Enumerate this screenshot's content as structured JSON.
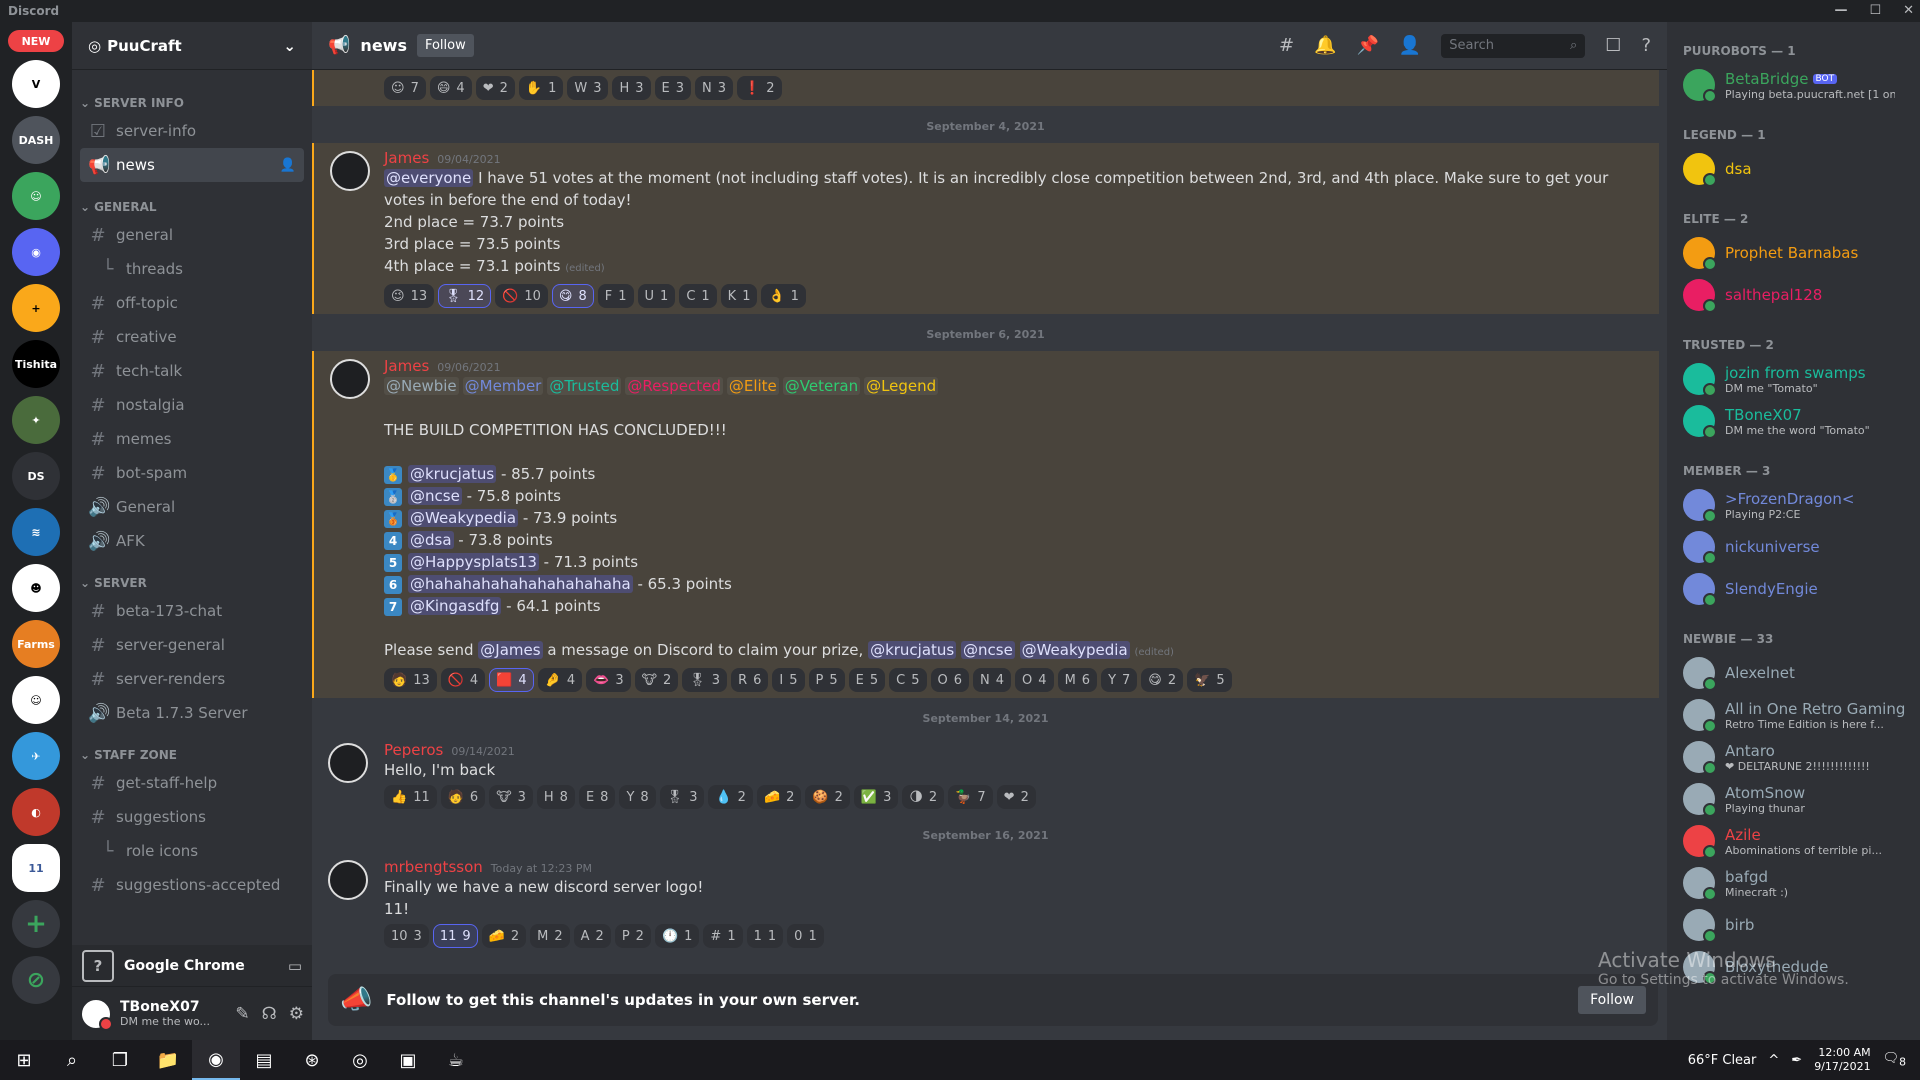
{
  "app": {
    "title": "Discord",
    "controls": [
      "—",
      "☐",
      "✕"
    ]
  },
  "guilds": {
    "new_badge": "NEW",
    "items": [
      {
        "name": "V",
        "color": "#ffffff",
        "fg": "#000000"
      },
      {
        "name": "DASH",
        "color": "#4f545c",
        "fg": "#ffffff"
      },
      {
        "name": "☺",
        "color": "#3ba55d",
        "fg": "#ffffff"
      },
      {
        "name": "◉",
        "color": "#5865f2",
        "fg": "#ffffff"
      },
      {
        "name": "+",
        "color": "#faa81a",
        "fg": "#000000"
      },
      {
        "name": "Tishita",
        "color": "#000000",
        "fg": "#ffffff"
      },
      {
        "name": "✦",
        "color": "#4a6b3c",
        "fg": "#ffffff"
      },
      {
        "name": "DS",
        "color": "#2f3136",
        "fg": "#ffffff"
      },
      {
        "name": "≋",
        "color": "#1e6fb4",
        "fg": "#ffffff"
      },
      {
        "name": "☻",
        "color": "#ffffff",
        "fg": "#000000"
      },
      {
        "name": "Farms",
        "color": "#e67e22",
        "fg": "#ffffff"
      },
      {
        "name": "☺",
        "color": "#ffffff",
        "fg": "#000000"
      },
      {
        "name": "✈",
        "color": "#3498db",
        "fg": "#ffffff"
      },
      {
        "name": "◐",
        "color": "#c0392b",
        "fg": "#ffffff"
      },
      {
        "name": "11",
        "color": "#ffffff",
        "fg": "#3b5998"
      }
    ],
    "add": "+",
    "explore": "⊘"
  },
  "server": {
    "name": "PuuCraft"
  },
  "categories": [
    {
      "name": "SERVER INFO",
      "channels": [
        {
          "sym": "☑",
          "name": "server-info",
          "active": false,
          "sub": false
        },
        {
          "sym": "📢",
          "name": "news",
          "active": true,
          "sub": false
        }
      ]
    },
    {
      "name": "GENERAL",
      "channels": [
        {
          "sym": "#",
          "name": "general",
          "active": false,
          "sub": false
        },
        {
          "sym": "└",
          "name": "threads",
          "active": false,
          "sub": true
        },
        {
          "sym": "#",
          "name": "off-topic",
          "active": false,
          "sub": false
        },
        {
          "sym": "#",
          "name": "creative",
          "active": false,
          "sub": false
        },
        {
          "sym": "#",
          "name": "tech-talk",
          "active": false,
          "sub": false
        },
        {
          "sym": "#",
          "name": "nostalgia",
          "active": false,
          "sub": false
        },
        {
          "sym": "#",
          "name": "memes",
          "active": false,
          "sub": false
        },
        {
          "sym": "#",
          "name": "bot-spam",
          "active": false,
          "sub": false
        },
        {
          "sym": "🔊",
          "name": "General",
          "active": false,
          "sub": false
        },
        {
          "sym": "🔊",
          "name": "AFK",
          "active": false,
          "sub": false
        }
      ]
    },
    {
      "name": "SERVER",
      "channels": [
        {
          "sym": "#",
          "name": "beta-173-chat",
          "active": false,
          "sub": false
        },
        {
          "sym": "#",
          "name": "server-general",
          "active": false,
          "sub": false
        },
        {
          "sym": "#",
          "name": "server-renders",
          "active": false,
          "sub": false
        },
        {
          "sym": "🔊",
          "name": "Beta 1.7.3 Server",
          "active": false,
          "sub": false
        }
      ]
    },
    {
      "name": "STAFF ZONE",
      "channels": [
        {
          "sym": "#",
          "name": "get-staff-help",
          "active": false,
          "sub": false
        },
        {
          "sym": "#",
          "name": "suggestions",
          "active": false,
          "sub": false
        },
        {
          "sym": "└",
          "name": "role icons",
          "active": false,
          "sub": true
        },
        {
          "sym": "#",
          "name": "suggestions-accepted",
          "active": false,
          "sub": false
        }
      ]
    }
  ],
  "activity": {
    "name": "Google Chrome",
    "icon": "?"
  },
  "user": {
    "name": "TBoneX07",
    "status": "DM me the wo..."
  },
  "channel": {
    "name": "news",
    "follow": "Follow",
    "search_placeholder": "Search"
  },
  "top_reactions": [
    {
      "e": "☺",
      "c": "7"
    },
    {
      "e": "😄",
      "c": "4"
    },
    {
      "e": "❤",
      "c": "2"
    },
    {
      "e": "✋",
      "c": "1"
    },
    {
      "e": "W",
      "c": "3"
    },
    {
      "e": "H",
      "c": "3"
    },
    {
      "e": "E",
      "c": "3"
    },
    {
      "e": "N",
      "c": "3"
    },
    {
      "e": "❗",
      "c": "2"
    }
  ],
  "messages": [
    {
      "date": "September 4, 2021",
      "author": "James",
      "ts": "09/04/2021",
      "hl": true,
      "lines": [
        {
          "mention": "@everyone",
          "text": " I have 51 votes at the moment (not including staff votes). It is an incredibly close competition between 2nd, 3rd, and 4th place. Make sure to get your votes in before the end of today!"
        },
        {
          "mention": "",
          "text": "2nd place = 73.7 points"
        },
        {
          "mention": "",
          "text": "3rd place = 73.5 points"
        },
        {
          "mention": "",
          "text": "4th place = 73.1 points",
          "edited": "(edited)"
        }
      ],
      "reactions": [
        {
          "e": "😉",
          "c": "13",
          "me": false
        },
        {
          "e": "🎖",
          "c": "12",
          "me": true
        },
        {
          "e": "🚫",
          "c": "10",
          "me": false
        },
        {
          "e": "😋",
          "c": "8",
          "me": true
        },
        {
          "e": "F",
          "c": "1",
          "me": false
        },
        {
          "e": "U",
          "c": "1",
          "me": false
        },
        {
          "e": "C",
          "c": "1",
          "me": false
        },
        {
          "e": "K",
          "c": "1",
          "me": false
        },
        {
          "e": "👌",
          "c": "1",
          "me": false
        }
      ]
    },
    {
      "date": "September 6, 2021",
      "author": "James",
      "ts": "09/06/2021",
      "hl": true,
      "roles": [
        "@Newbie",
        "@Member",
        "@Trusted",
        "@Respected",
        "@Elite",
        "@Veteran",
        "@Legend"
      ],
      "headline": "THE BUILD COMPETITION HAS CONCLUDED!!!",
      "ranks": [
        {
          "r": "🥇",
          "u": "@krucjatus",
          "p": " - 85.7 points"
        },
        {
          "r": "🥈",
          "u": "@ncse",
          "p": " - 75.8 points"
        },
        {
          "r": "🥉",
          "u": "@Weakypedia",
          "p": " - 73.9 points"
        },
        {
          "r": "4",
          "u": "@dsa",
          "p": " - 73.8 points"
        },
        {
          "r": "5",
          "u": "@Happysplats13",
          "p": " - 71.3 points"
        },
        {
          "r": "6",
          "u": "@hahahahahahahahahahaha",
          "p": " - 65.3 points"
        },
        {
          "r": "7",
          "u": "@Kingasdfg",
          "p": " - 64.1 points"
        }
      ],
      "closing": {
        "a": "Please send ",
        "m1": "@James",
        "b": " a message on Discord to claim your prize, ",
        "m2": "@krucjatus",
        "m3": "@ncse",
        "m4": "@Weakypedia",
        "edited": "(edited)"
      },
      "reactions": [
        {
          "e": "🧑",
          "c": "13",
          "me": false
        },
        {
          "e": "🚫",
          "c": "4",
          "me": false
        },
        {
          "e": "🟥",
          "c": "4",
          "me": true
        },
        {
          "e": "🤌",
          "c": "4",
          "me": false
        },
        {
          "e": "👄",
          "c": "3",
          "me": false
        },
        {
          "e": "🐮",
          "c": "2",
          "me": false
        },
        {
          "e": "🎖",
          "c": "3",
          "me": false
        },
        {
          "e": "R",
          "c": "6",
          "me": false
        },
        {
          "e": "I",
          "c": "5",
          "me": false
        },
        {
          "e": "P",
          "c": "5",
          "me": false
        },
        {
          "e": "E",
          "c": "5",
          "me": false
        },
        {
          "e": "C",
          "c": "5",
          "me": false
        },
        {
          "e": "O",
          "c": "6",
          "me": false
        },
        {
          "e": "N",
          "c": "4",
          "me": false
        },
        {
          "e": "O",
          "c": "4",
          "me": false
        },
        {
          "e": "M",
          "c": "6",
          "me": false
        },
        {
          "e": "Y",
          "c": "7",
          "me": false
        },
        {
          "e": "😋",
          "c": "2",
          "me": false
        },
        {
          "e": "🦅",
          "c": "5",
          "me": false
        }
      ]
    },
    {
      "date": "September 14, 2021",
      "author": "Peperos",
      "ts": "09/14/2021",
      "hl": false,
      "lines": [
        {
          "mention": "",
          "text": "Hello, I'm back"
        }
      ],
      "reactions": [
        {
          "e": "👍",
          "c": "11",
          "me": false
        },
        {
          "e": "🧑",
          "c": "6",
          "me": false
        },
        {
          "e": "🐮",
          "c": "3",
          "me": false
        },
        {
          "e": "H",
          "c": "8",
          "me": false
        },
        {
          "e": "E",
          "c": "8",
          "me": false
        },
        {
          "e": "Y",
          "c": "8",
          "me": false
        },
        {
          "e": "🎖",
          "c": "3",
          "me": false
        },
        {
          "e": "💧",
          "c": "2",
          "me": false
        },
        {
          "e": "🧀",
          "c": "2",
          "me": false
        },
        {
          "e": "🍪",
          "c": "2",
          "me": false
        },
        {
          "e": "✅",
          "c": "3",
          "me": false
        },
        {
          "e": "🌗",
          "c": "2",
          "me": false
        },
        {
          "e": "🦆",
          "c": "7",
          "me": false
        },
        {
          "e": "❤",
          "c": "2",
          "me": false
        }
      ]
    },
    {
      "date": "September 16, 2021",
      "author": "mrbengtsson",
      "ts": "Today at 12:23 PM",
      "hl": false,
      "lines": [
        {
          "mention": "",
          "text": "Finally we have a new discord server logo!"
        },
        {
          "mention": "",
          "text": "11!"
        }
      ],
      "reactions": [
        {
          "e": "10",
          "c": "3",
          "me": false
        },
        {
          "e": "11",
          "c": "9",
          "me": true
        },
        {
          "e": "🧀",
          "c": "2",
          "me": false
        },
        {
          "e": "M",
          "c": "2",
          "me": false
        },
        {
          "e": "A",
          "c": "2",
          "me": false
        },
        {
          "e": "P",
          "c": "2",
          "me": false
        },
        {
          "e": "🕛",
          "c": "1",
          "me": false
        },
        {
          "e": "#",
          "c": "1",
          "me": false
        },
        {
          "e": "1",
          "c": "1",
          "me": false
        },
        {
          "e": "0",
          "c": "1",
          "me": false
        }
      ]
    }
  ],
  "followbar": {
    "text": "Follow to get this channel's updates in your own server.",
    "button": "Follow"
  },
  "members": [
    {
      "cat": "PUUROBOTS — 1",
      "list": [
        {
          "n": "BetaBridge",
          "c": "#3ba55d",
          "bot": "BOT",
          "s": "Playing beta.puucraft.net [1 on..."
        }
      ]
    },
    {
      "cat": "LEGEND — 1",
      "list": [
        {
          "n": "dsa",
          "c": "#f1c40f",
          "s": ""
        }
      ]
    },
    {
      "cat": "ELITE — 2",
      "list": [
        {
          "n": "Prophet Barnabas",
          "c": "#f39c12",
          "s": ""
        },
        {
          "n": "salthepal128",
          "c": "#e91e63",
          "s": ""
        }
      ]
    },
    {
      "cat": "TRUSTED — 2",
      "list": [
        {
          "n": "jozin from swamps",
          "c": "#1abc9c",
          "s": "DM me \"Tomato\""
        },
        {
          "n": "TBoneX07",
          "c": "#1abc9c",
          "s": "DM me the word \"Tomato\""
        }
      ]
    },
    {
      "cat": "MEMBER — 3",
      "list": [
        {
          "n": ">FrozenDragon<",
          "c": "#7289da",
          "s": "Playing P2:CE"
        },
        {
          "n": "nickuniverse",
          "c": "#7289da",
          "s": ""
        },
        {
          "n": "SlendyEngie",
          "c": "#7289da",
          "s": ""
        }
      ]
    },
    {
      "cat": "NEWBIE — 33",
      "list": [
        {
          "n": "Alexelnet",
          "c": "#99aab5",
          "s": ""
        },
        {
          "n": "All in One Retro Gaming",
          "c": "#99aab5",
          "s": "Retro Time Edition is here f..."
        },
        {
          "n": "Antaro",
          "c": "#99aab5",
          "s": "❤ DELTARUNE 2!!!!!!!!!!!!!"
        },
        {
          "n": "AtomSnow",
          "c": "#99aab5",
          "s": "Playing thunar"
        },
        {
          "n": "Azile",
          "c": "#ed4245",
          "s": "Abominations of terrible pi..."
        },
        {
          "n": "bafgd",
          "c": "#99aab5",
          "s": "Minecraft :)"
        },
        {
          "n": "birb",
          "c": "#99aab5",
          "s": ""
        },
        {
          "n": "Bloxythedude",
          "c": "#99aab5",
          "s": ""
        }
      ]
    }
  ],
  "watermark": {
    "title": "Activate Windows",
    "sub": "Go to Settings to activate Windows."
  },
  "taskbar": {
    "icons": [
      "⊞",
      "⌕",
      "❐",
      "📁",
      "◉",
      "▤",
      "⊛",
      "◎",
      "▣",
      "☕"
    ],
    "weather": "66°F  Clear",
    "time": "12:00 AM",
    "date": "9/17/2021",
    "notif": "8"
  }
}
